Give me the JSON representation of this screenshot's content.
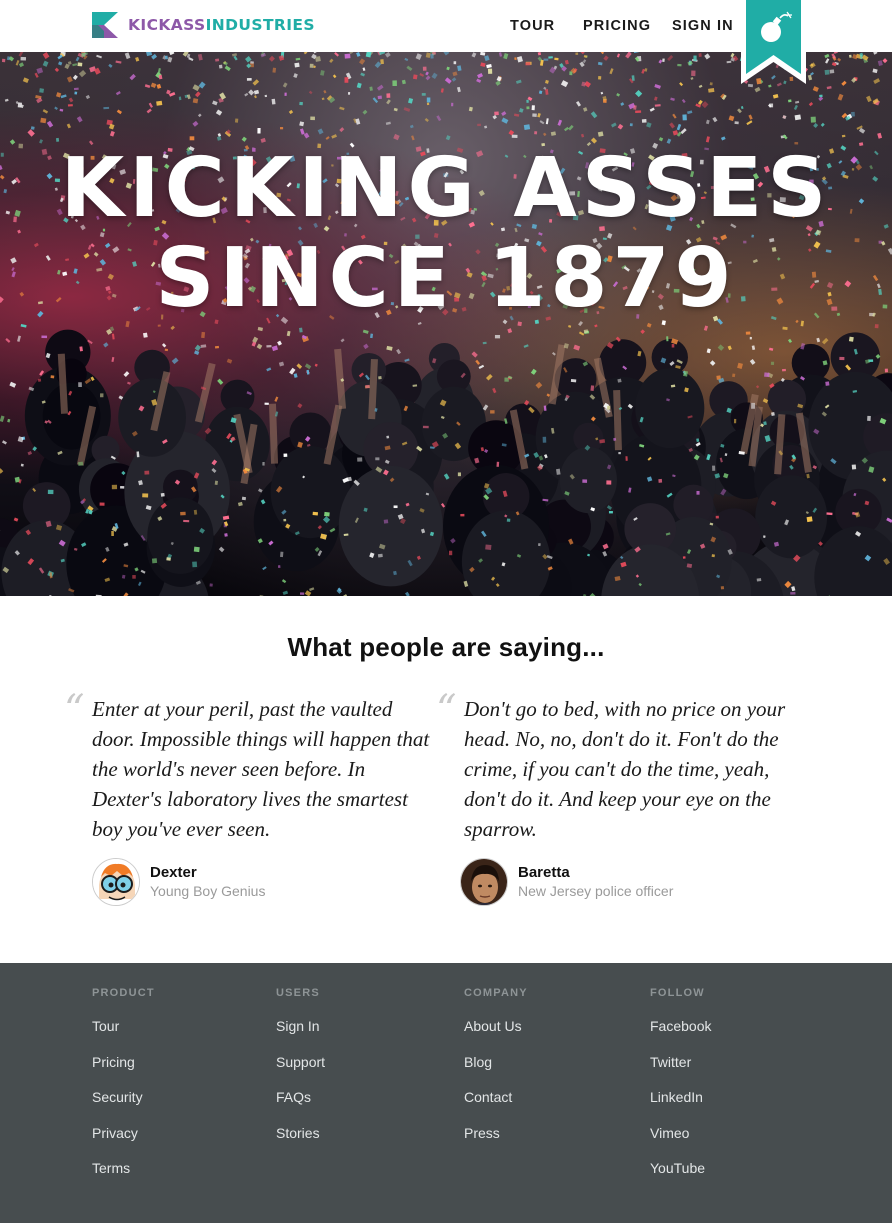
{
  "brand": {
    "name_part1": "KICKASS",
    "name_part2": "INDUSTRIES",
    "colors": {
      "purple": "#8d58a8",
      "teal": "#20ada6",
      "dark": "#474d4f"
    }
  },
  "nav": {
    "items": [
      {
        "label": "TOUR"
      },
      {
        "label": "PRICING"
      },
      {
        "label": "SIGN IN"
      }
    ],
    "ribbon_icon": "bomb-icon"
  },
  "hero": {
    "line1": "KICKING ASSES",
    "line2": "SINCE 1879",
    "background_icon": "confetti-crowd-photo"
  },
  "testimonials": {
    "heading": "What people are saying...",
    "items": [
      {
        "quote": "Enter at your peril, past the vaulted door. Impossible things will happen that the world's never seen before. In Dexter's laboratory lives the smartest boy you've ever seen.",
        "name": "Dexter",
        "role": "Young Boy Genius",
        "avatar_icon": "dexter-avatar"
      },
      {
        "quote": "Don't go to bed, with no price on your head. No, no, don't do it. Fon't do the crime, if you can't do the time, yeah, don't do it. And keep your eye on the sparrow.",
        "name": "Baretta",
        "role": "New Jersey police officer",
        "avatar_icon": "baretta-avatar"
      }
    ]
  },
  "footer": {
    "columns": [
      {
        "heading": "PRODUCT",
        "links": [
          "Tour",
          "Pricing",
          "Security",
          "Privacy",
          "Terms"
        ]
      },
      {
        "heading": "USERS",
        "links": [
          "Sign In",
          "Support",
          "FAQs",
          "Stories"
        ]
      },
      {
        "heading": "COMPANY",
        "links": [
          "About Us",
          "Blog",
          "Contact",
          "Press"
        ]
      },
      {
        "heading": "FOLLOW",
        "links": [
          "Facebook",
          "Twitter",
          "LinkedIn",
          "Vimeo",
          "YouTube"
        ]
      }
    ]
  }
}
